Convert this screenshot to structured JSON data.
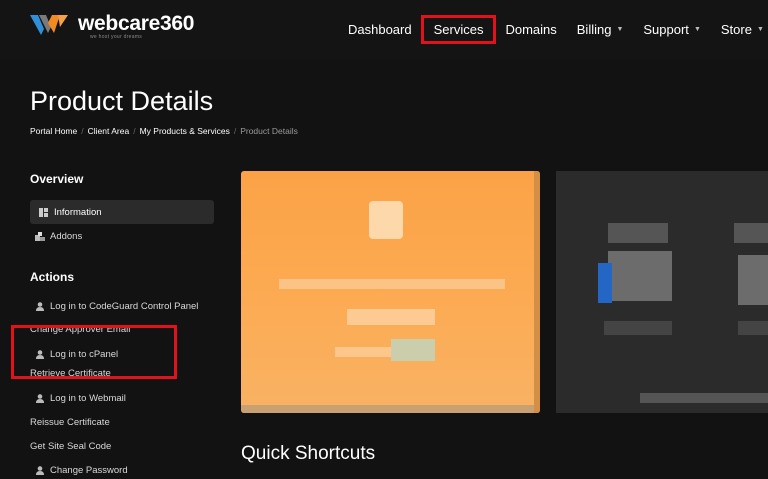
{
  "brand": {
    "name": "webcare360",
    "tagline": "we host your dreams",
    "colors": {
      "logo_blue": "#2f8fd8",
      "logo_orange": "#f28a22"
    }
  },
  "nav": [
    {
      "label": "Dashboard",
      "has_dropdown": false,
      "highlighted": false
    },
    {
      "label": "Services",
      "has_dropdown": false,
      "highlighted": true
    },
    {
      "label": "Domains",
      "has_dropdown": false,
      "highlighted": false
    },
    {
      "label": "Billing",
      "has_dropdown": true,
      "highlighted": false
    },
    {
      "label": "Support",
      "has_dropdown": true,
      "highlighted": false
    },
    {
      "label": "Store",
      "has_dropdown": true,
      "highlighted": false
    }
  ],
  "page": {
    "title": "Product Details",
    "breadcrumb": [
      "Portal Home",
      "Client Area",
      "My Products & Services",
      "Product Details"
    ]
  },
  "sidebar": {
    "overview": {
      "heading": "Overview",
      "items": [
        {
          "label": "Information",
          "icon": "grid-icon",
          "active": true
        },
        {
          "label": "Addons",
          "icon": "cubes-icon",
          "active": false
        }
      ]
    },
    "actions": {
      "heading": "Actions",
      "items": [
        {
          "label": "Log in to CodeGuard Control Panel",
          "icon": "user-icon"
        },
        {
          "label": "Change Approver Email",
          "icon": ""
        },
        {
          "label": "Log in to cPanel",
          "icon": "user-icon"
        },
        {
          "label": "Retrieve Certificate",
          "icon": ""
        },
        {
          "label": "Log in to Webmail",
          "icon": "user-icon"
        },
        {
          "label": "Reissue Certificate",
          "icon": ""
        },
        {
          "label": "Get Site Seal Code",
          "icon": ""
        },
        {
          "label": "Change Password",
          "icon": "user-icon"
        }
      ]
    }
  },
  "main": {
    "shortcuts_title": "Quick Shortcuts",
    "colors": {
      "card_orange": "#fba246",
      "card_dark": "#2b2b2b",
      "highlight_red": "#e0121b"
    }
  }
}
